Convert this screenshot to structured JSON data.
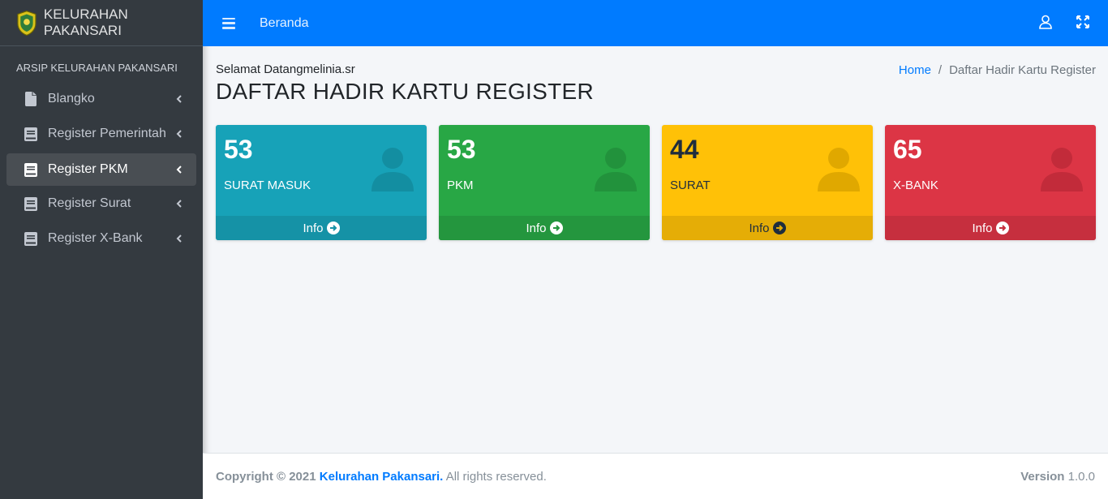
{
  "sidebar": {
    "brand": "KELURAHAN PAKANSARI",
    "header": "ARSIP KELURAHAN PAKANSARI",
    "items": [
      {
        "label": "Blangko",
        "icon": "file-icon"
      },
      {
        "label": "Register Pemerintah",
        "icon": "book-icon"
      },
      {
        "label": "Register PKM",
        "icon": "book-icon",
        "active": true
      },
      {
        "label": "Register Surat",
        "icon": "book-icon"
      },
      {
        "label": "Register X-Bank",
        "icon": "book-icon"
      }
    ]
  },
  "topbar": {
    "link": "Beranda",
    "color": "#007bff"
  },
  "content": {
    "greeting": "Selamat Datangmelinia.sr",
    "title": "DAFTAR HADIR KARTU REGISTER",
    "breadcrumb": {
      "home": "Home",
      "separator": "/",
      "current": "Daftar Hadir Kartu Register"
    }
  },
  "boxes": [
    {
      "number": "53",
      "label": "SURAT MASUK",
      "footer": "Info",
      "color": "#17a2b8",
      "footer_color": "#1592a6",
      "icon_color": "#138ea1",
      "text_color": "#ffffff"
    },
    {
      "number": "53",
      "label": "PKM",
      "footer": "Info",
      "color": "#28a745",
      "footer_color": "#24963e",
      "icon_color": "#22923c",
      "text_color": "#ffffff"
    },
    {
      "number": "44",
      "label": "SURAT",
      "footer": "Info",
      "color": "#ffc107",
      "footer_color": "#e5ad06",
      "icon_color": "#e0a800",
      "text_color": "#1f2d3d"
    },
    {
      "number": "65",
      "label": "X-BANK",
      "footer": "Info",
      "color": "#dc3545",
      "footer_color": "#c62f3e",
      "icon_color": "#c22b3a",
      "text_color": "#ffffff"
    }
  ],
  "footer": {
    "copyright": "Copyright © 2021",
    "org": "Kelurahan Pakansari.",
    "rights": "All rights reserved.",
    "version_label": "Version",
    "version": "1.0.0"
  }
}
